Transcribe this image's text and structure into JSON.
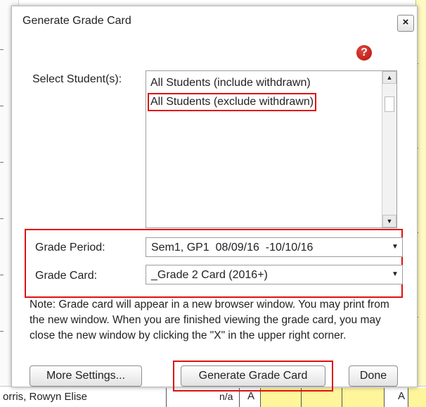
{
  "dialog": {
    "title": "Generate Grade Card",
    "close_label": "×",
    "help_label": "?",
    "select_students_label": "Select Student(s):",
    "student_options": [
      "All Students (include withdrawn)",
      "All Students (exclude withdrawn)"
    ],
    "selected_student_option": "All Students (exclude withdrawn)",
    "grade_period_label": "Grade Period:",
    "grade_period_value": "Sem1, GP1  08/09/16  -10/10/16",
    "grade_card_label": "Grade Card:",
    "grade_card_value": "_Grade 2 Card (2016+)",
    "note": "Note: Grade card will appear in a new browser window. You may print from the new window. When you are finished viewing the grade card, you may close the new window by clicking the \"X\" in the upper right corner.",
    "buttons": {
      "more_settings": "More Settings...",
      "generate": "Generate Grade Card",
      "done": "Done"
    }
  },
  "background_row": {
    "student_name": "orris, Rowyn Elise",
    "value": "n/a",
    "grade_1": "A",
    "grade_2": "A"
  },
  "colors": {
    "highlight": "#e01010",
    "help_icon": "#c0150f",
    "grade_cell": "#fff59a"
  },
  "icons": {
    "close": "close-icon",
    "help": "help-icon",
    "scroll_up": "scroll-up-arrow-icon",
    "scroll_down": "scroll-down-arrow-icon",
    "dropdown": "chevron-down-icon"
  }
}
